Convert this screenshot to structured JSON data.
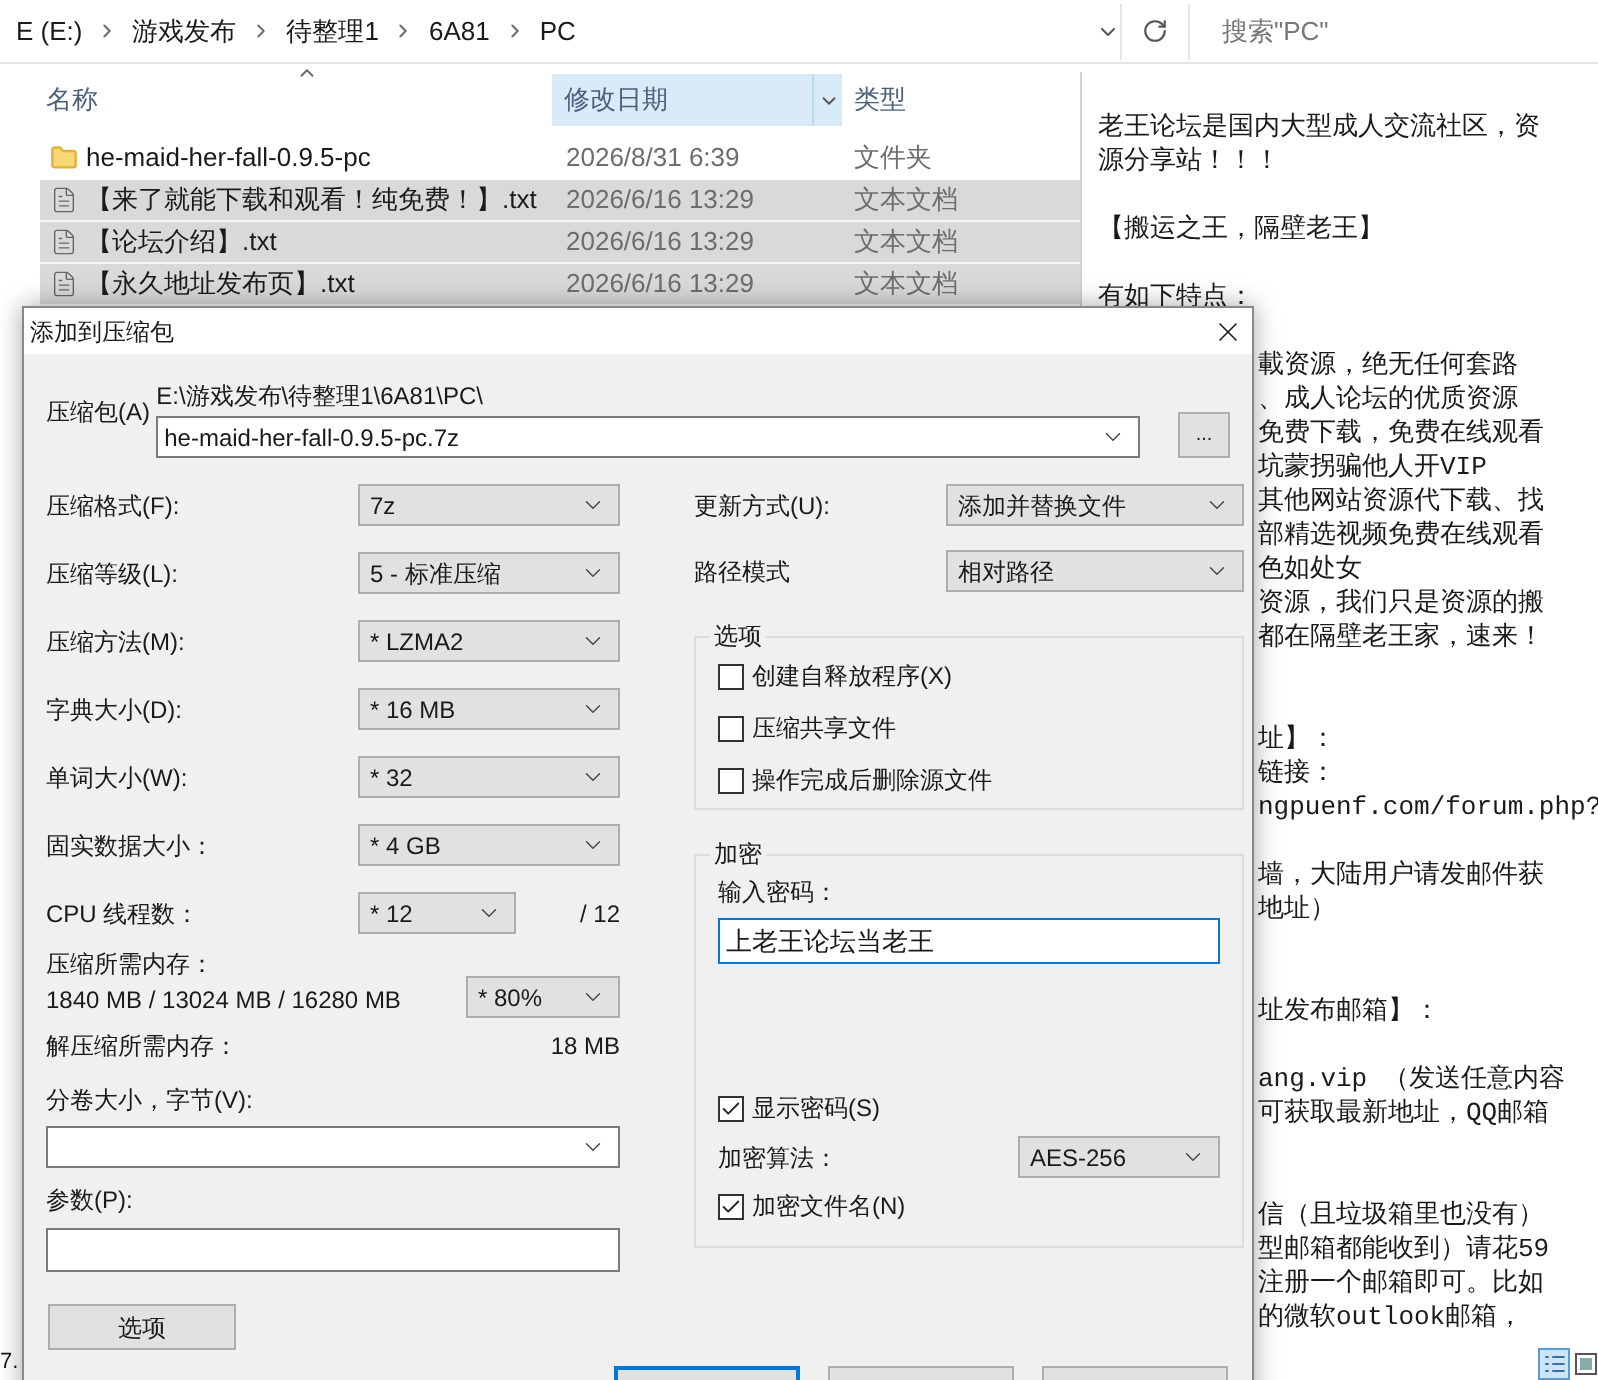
{
  "explorer": {
    "breadcrumb": [
      "E (E:)",
      "游戏发布",
      "待整理1",
      "6A81",
      "PC"
    ],
    "search": {
      "placeholder": "搜索\"PC\""
    },
    "columns": [
      {
        "label": "名称",
        "sorted": true,
        "highlighted": false
      },
      {
        "label": "修改日期",
        "sorted": false,
        "highlighted": true
      },
      {
        "label": "类型",
        "sorted": false,
        "highlighted": false
      }
    ],
    "rows": [
      {
        "kind": "folder",
        "name": "he-maid-her-fall-0.9.5-pc",
        "date": "2026/8/31 6:39",
        "type": "文件夹",
        "selected": false
      },
      {
        "kind": "text",
        "name": "【来了就能下载和观看！纯免费！】.txt",
        "date": "2026/6/16 13:29",
        "type": "文本文档",
        "selected": true
      },
      {
        "kind": "text",
        "name": "【论坛介绍】.txt",
        "date": "2026/6/16 13:29",
        "type": "文本文档",
        "selected": true
      },
      {
        "kind": "text",
        "name": "【永久地址发布页】.txt",
        "date": "2026/6/16 13:29",
        "type": "文本文档",
        "selected": true
      }
    ],
    "status_text": "7."
  },
  "notepad": {
    "lines": [
      {
        "kind": "full",
        "text": "老王论坛是国内大型成人交流社区，资"
      },
      {
        "kind": "full",
        "text": "源分享站！！！"
      },
      {
        "kind": "blank"
      },
      {
        "kind": "full",
        "text": "【搬运之王，隔壁老王】"
      },
      {
        "kind": "blank"
      },
      {
        "kind": "full",
        "text": "有如下特点："
      },
      {
        "kind": "blank"
      },
      {
        "kind": "clipped",
        "text": "載资源，绝无任何套路"
      },
      {
        "kind": "clipped",
        "text": "、成人论坛的优质资源"
      },
      {
        "kind": "clipped",
        "text": "免费下载，免费在线观看"
      },
      {
        "kind": "clipped",
        "text": "坑蒙拐骗他人开VIP"
      },
      {
        "kind": "clipped",
        "text": "其他网站资源代下载、找"
      },
      {
        "kind": "clipped",
        "text": "部精选视频免费在线观看"
      },
      {
        "kind": "clipped",
        "text": "色如处女"
      },
      {
        "kind": "clipped",
        "text": "资源，我们只是资源的搬"
      },
      {
        "kind": "clipped",
        "text": "都在隔壁老王家，速来！"
      },
      {
        "kind": "blank"
      },
      {
        "kind": "blank"
      },
      {
        "kind": "clipped",
        "text": "址】："
      },
      {
        "kind": "clipped",
        "text": "链接："
      },
      {
        "kind": "clipped",
        "text": "ngpuenf.com/forum.php?"
      },
      {
        "kind": "blank"
      },
      {
        "kind": "clipped",
        "text": "墙，大陆用户请发邮件获"
      },
      {
        "kind": "clipped",
        "text": "地址）"
      },
      {
        "kind": "blank"
      },
      {
        "kind": "blank"
      },
      {
        "kind": "clipped",
        "text": "址发布邮箱】："
      },
      {
        "kind": "blank"
      },
      {
        "kind": "clipped",
        "text": "ang.vip  （发送任意内容"
      },
      {
        "kind": "clipped",
        "text": "可获取最新地址，QQ邮箱"
      },
      {
        "kind": "blank"
      },
      {
        "kind": "blank"
      },
      {
        "kind": "clipped",
        "text": "信（且垃圾箱里也没有）"
      },
      {
        "kind": "clipped",
        "text": "型邮箱都能收到）请花59"
      },
      {
        "kind": "clipped",
        "text": "注册一个邮箱即可。比如"
      },
      {
        "kind": "clipped",
        "text": "的微软outlook邮箱，"
      }
    ]
  },
  "dialog": {
    "title": "添加到压缩包",
    "archive": {
      "label": "压缩包(A)",
      "path": "E:\\游戏发布\\待整理1\\6A81\\PC\\",
      "value": "he-maid-her-fall-0.9.5-pc.7z",
      "browse": "..."
    },
    "settings": [
      {
        "kind": "combo",
        "label": "压缩格式(F):",
        "value": "7z"
      },
      {
        "kind": "combo",
        "label": "压缩等级(L):",
        "value": "5 - 标准压缩"
      },
      {
        "kind": "combo",
        "label": "压缩方法(M):",
        "value": "* LZMA2"
      },
      {
        "kind": "combo",
        "label": "字典大小(D):",
        "value": "* 16 MB"
      },
      {
        "kind": "combo",
        "label": "单词大小(W):",
        "value": "* 32"
      },
      {
        "kind": "combo",
        "label": "固实数据大小：",
        "value": "* 4 GB"
      },
      {
        "kind": "threads",
        "label": "CPU 线程数：",
        "value": "* 12",
        "suffix": "/ 12"
      }
    ],
    "memory": {
      "label": "压缩所需内存：",
      "value": "1840 MB / 13024 MB / 16280 MB",
      "limit": "* 80%"
    },
    "decompress": {
      "label": "解压缩所需内存：",
      "value": "18 MB"
    },
    "volume": {
      "label": "分卷大小，字节(V):"
    },
    "parameters": {
      "label": "参数(P):"
    },
    "options_button": "选项",
    "update_mode": {
      "label": "更新方式(U):",
      "value": "添加并替换文件"
    },
    "path_mode": {
      "label": "路径模式",
      "value": "相对路径"
    },
    "options": {
      "title": "选项",
      "items": [
        {
          "label": "创建自释放程序(X)",
          "checked": false
        },
        {
          "label": "压缩共享文件",
          "checked": false
        },
        {
          "label": "操作完成后删除源文件",
          "checked": false
        }
      ]
    },
    "encryption": {
      "title": "加密",
      "password_label": "输入密码：",
      "password": "上老王论坛当老王",
      "show_password": {
        "label": "显示密码(S)",
        "checked": true
      },
      "method": {
        "label": "加密算法：",
        "value": "AES-256"
      },
      "encrypt_names": {
        "label": "加密文件名(N)",
        "checked": true
      }
    }
  }
}
